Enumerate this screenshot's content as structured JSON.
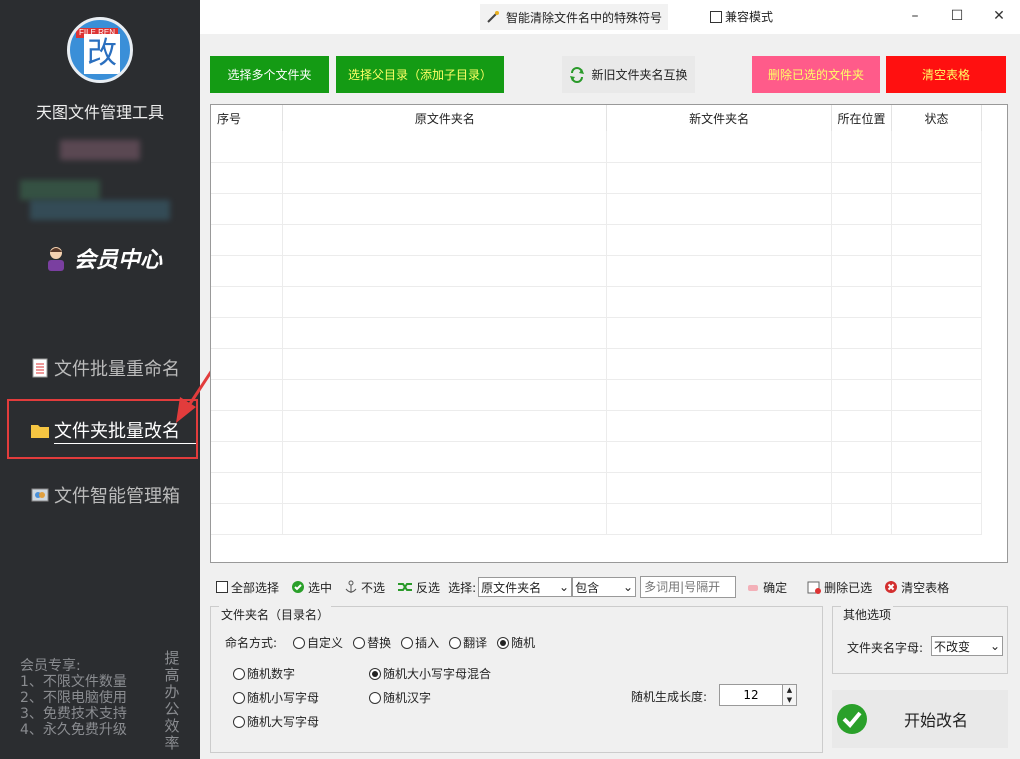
{
  "app": {
    "logo_tag": "FILE REN",
    "logo_char": "改",
    "title": "天图文件管理工具",
    "member": "会员中心"
  },
  "nav": [
    {
      "label": "文件批量重命名"
    },
    {
      "label": "文件夹批量改名"
    },
    {
      "label": "文件智能管理箱"
    }
  ],
  "perks": {
    "title": "会员专享:",
    "items": [
      "1、不限文件数量",
      "2、不限电脑使用",
      "3、免费技术支持",
      "4、永久免费升级"
    ],
    "vertical": "提高办公效率"
  },
  "topbar": {
    "feature": "智能清除文件名中的特殊符号",
    "compat": "兼容模式",
    "min": "–",
    "max": "☐",
    "close": "✕"
  },
  "buttons": {
    "multi": "选择多个文件夹",
    "parent": "选择父目录（添加子目录）",
    "swap": "新旧文件夹名互换",
    "del_sel": "删除已选的文件夹",
    "clear": "清空表格"
  },
  "colors": {
    "green": "#149b14",
    "pink": "#ff5b8a",
    "red": "#ff1010",
    "yellow": "#ffff66"
  },
  "table": {
    "headers": [
      "序号",
      "原文件夹名",
      "新文件夹名",
      "所在位置",
      "状态"
    ]
  },
  "toolbar": {
    "select_all": "全部选择",
    "select": "选中",
    "unselect": "不选",
    "invert": "反选",
    "choose": "选择:",
    "field": "原文件夹名",
    "op": "包含",
    "placeholder": "多词用|号隔开",
    "confirm": "确定",
    "delete_sel": "删除已选",
    "clear": "清空表格"
  },
  "naming": {
    "legend": "文件夹名（目录名）",
    "mode_label": "命名方式:",
    "modes": [
      "自定义",
      "替换",
      "插入",
      "翻译",
      "随机"
    ],
    "selected_mode": "随机",
    "options": [
      "随机数字",
      "随机小写字母",
      "随机大写字母",
      "随机大小写字母混合",
      "随机汉字"
    ],
    "selected_option": "随机大小写字母混合",
    "length_label": "随机生成长度:",
    "length": "12"
  },
  "other": {
    "legend": "其他选项",
    "case_label": "文件夹名字母:",
    "case_value": "不改变"
  },
  "start": {
    "label": "开始改名"
  }
}
